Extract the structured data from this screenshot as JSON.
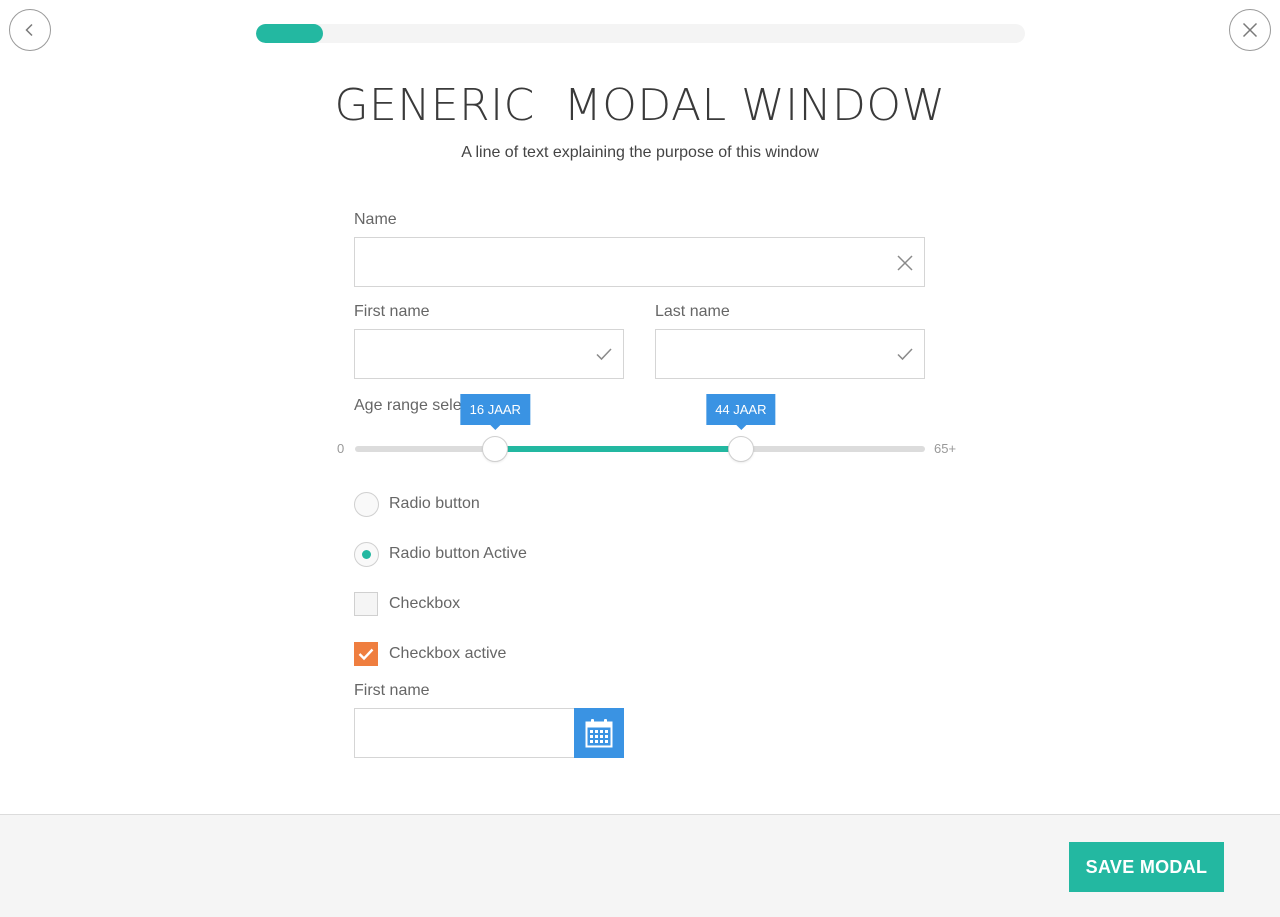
{
  "header": {
    "back_icon": "chevron-left-icon",
    "close_icon": "close-icon",
    "progress_percent": 8.7
  },
  "title": "GENERIC  MODAL WINDOW",
  "subtitle": "A line of text explaining the purpose of this window",
  "form": {
    "name": {
      "label": "Name",
      "value": "",
      "icon": "clear-x-icon"
    },
    "first_name": {
      "label": "First name",
      "value": "",
      "icon": "check-icon"
    },
    "last_name": {
      "label": "Last name",
      "value": "",
      "icon": "check-icon"
    },
    "age_range": {
      "label": "Age range selector",
      "min_label": "0",
      "max_label": "65+",
      "min": 0,
      "max": 65,
      "low_value": 16,
      "high_value": 44,
      "low_tip": "16 JAAR",
      "high_tip": "44 JAAR"
    },
    "radio_1": {
      "label": "Radio button",
      "checked": false
    },
    "radio_2": {
      "label": "Radio button Active",
      "checked": true
    },
    "checkbox_1": {
      "label": "Checkbox",
      "checked": false
    },
    "checkbox_2": {
      "label": "Checkbox active",
      "checked": true
    },
    "date": {
      "label": "First name",
      "value": "",
      "icon": "calendar-icon"
    }
  },
  "colors": {
    "accent": "#23b8a1",
    "blue": "#3a93e3",
    "orange": "#ef7e3f"
  },
  "footer": {
    "save_label": "SAVE MODAL"
  }
}
